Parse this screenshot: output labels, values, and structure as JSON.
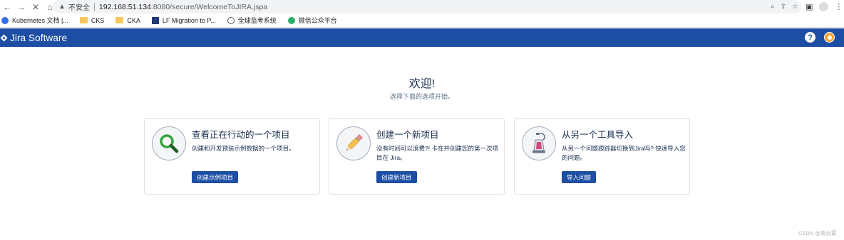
{
  "browser": {
    "security_label": "不安全",
    "url_host": "192.168.51.134",
    "url_path": ":8080/secure/WelcomeToJIRA.jspa",
    "bookmarks": [
      {
        "label": "Kubernetes 文档 |...",
        "icon": "kubernetes-icon"
      },
      {
        "label": "CKS",
        "icon": "folder-icon"
      },
      {
        "label": "CKA",
        "icon": "folder-icon"
      },
      {
        "label": "LF Migration to P...",
        "icon": "lf-icon"
      },
      {
        "label": "全球监考系统",
        "icon": "globe-icon"
      },
      {
        "label": "微信公众平台",
        "icon": "wechat-icon"
      }
    ]
  },
  "header": {
    "product_name": "Jira Software",
    "help_glyph": "?",
    "brand_color": "#1d4ea3"
  },
  "welcome": {
    "title": "欢迎!",
    "subtitle": "选择下面的选项开始。"
  },
  "cards": [
    {
      "title": "查看正在行动的一个项目",
      "description": "创建和开发预装示例数据的一个项目。",
      "button": "创建示例项目",
      "icon": "magnifier-icon"
    },
    {
      "title": "创建一个新项目",
      "description": "没有时间可以浪费?! 卡在并创建您的第一次项目在 Jira。",
      "button": "创建新项目",
      "icon": "pencil-icon"
    },
    {
      "title": "从另一个工具导入",
      "description": "从另一个问题跟踪器切换到Jira吗? 快速导入您的问题。",
      "button": "导入问题",
      "icon": "vacuum-icon"
    }
  ],
  "watermark": "CSDN @乘云雾"
}
